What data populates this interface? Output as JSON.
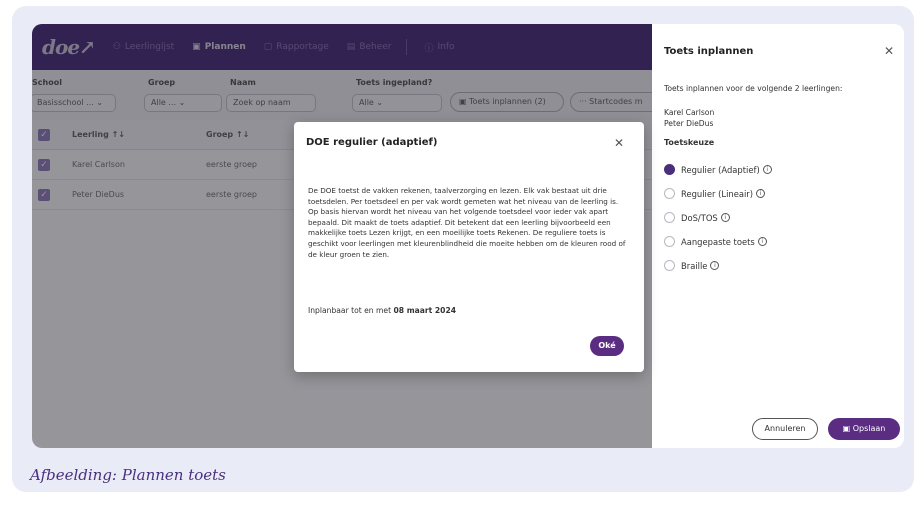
{
  "app": {
    "logo": "doe↗",
    "nav": [
      {
        "label": "Leerlingljst",
        "icon": "users-icon",
        "active": false
      },
      {
        "label": "Plannen",
        "icon": "calendar-icon",
        "active": true
      },
      {
        "label": "Rapportage",
        "icon": "report-icon",
        "active": false
      },
      {
        "label": "Beheer",
        "icon": "settings-icon",
        "active": false
      },
      {
        "label": "Info",
        "icon": "info-icon",
        "active": false
      }
    ]
  },
  "filters": {
    "school_label": "School",
    "school_value": "Basisschool ...",
    "group_label": "Groep",
    "group_value": "Alle ...",
    "name_label": "Naam",
    "name_placeholder": "Zoek op naam",
    "planned_label": "Toets ingepland?",
    "planned_value": "Alle",
    "plan_button": "Toets inplannen (2)",
    "startcodes_button": "Startcodes m"
  },
  "table": {
    "headers": {
      "student": "Leerling ↑↓",
      "group": "Groep ↑↓"
    },
    "rows": [
      {
        "student": "Karel Carlson",
        "group": "eerste groep"
      },
      {
        "student": "Peter DieDus",
        "group": "eerste groep"
      }
    ]
  },
  "panel": {
    "title": "Toets inplannen",
    "intro": "Toets inplannen voor de volgende 2 leerlingen:",
    "students": [
      "Karel Carlson",
      "Peter DieDus"
    ],
    "choice_label": "Toetskeuze",
    "options": [
      {
        "label": "Regulier (Adaptief)",
        "selected": true,
        "info": true
      },
      {
        "label": "Regulier (Lineair)",
        "selected": false,
        "info": true
      },
      {
        "label": "DoS/TOS",
        "selected": false,
        "info": true
      },
      {
        "label": "Aangepaste toets",
        "selected": false,
        "info": true
      },
      {
        "label": "Braille",
        "selected": false,
        "info": true
      }
    ],
    "cancel_label": "Annuleren",
    "save_label": "Opslaan"
  },
  "modal": {
    "title": "DOE regulier (adaptief)",
    "body": "De DOE toetst de vakken rekenen, taalverzorging en lezen. Elk vak bestaat uit drie toetsdelen. Per toetsdeel en per vak wordt gemeten wat het niveau van de leerling is. Op basis hiervan wordt het niveau van het volgende toetsdeel voor ieder vak apart bepaald. Dit maakt de toets adaptief. Dit betekent dat een leerling bijvoorbeeld een makkelijke toets Lezen krijgt, en een moeilijke toets Rekenen. De reguliere toets is geschikt voor leerlingen met kleurenblindheid die moeite hebben om de kleuren rood of de kleur groen te zien.",
    "date_prefix": "Inplanbaar tot en met ",
    "date_value": "08 maart 2024",
    "ok_label": "Oké"
  },
  "caption": "Afbeelding: Plannen toets",
  "colors": {
    "brand": "#4a2f7d",
    "button": "#5b2d82",
    "frame": "#e9ebf7"
  }
}
